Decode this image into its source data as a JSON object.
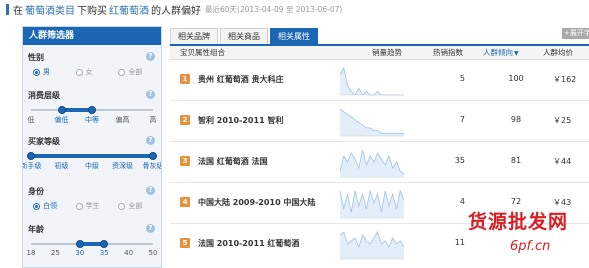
{
  "header": {
    "prefix": "在",
    "category": "葡萄酒类目",
    "mid": "下购买",
    "product": "红葡萄酒",
    "suffix": "的人群偏好",
    "date_range": "最近60天(2013-04-09 至 2013-06-07)"
  },
  "sidebar": {
    "title": "人群筛选器",
    "gender": {
      "label": "性别",
      "options": [
        {
          "label": "男",
          "selected": true
        },
        {
          "label": "女",
          "selected": false
        },
        {
          "label": "全部",
          "selected": false
        }
      ]
    },
    "spend": {
      "label": "消费层级",
      "ticks": [
        "低",
        "偏低",
        "中等",
        "偏高",
        "高"
      ],
      "range": [
        1,
        2
      ]
    },
    "buyer": {
      "label": "买家等级",
      "ticks": [
        "新手级",
        "初级",
        "中级",
        "资深级",
        "骨灰级"
      ],
      "range": [
        0,
        4
      ]
    },
    "identity": {
      "label": "身份",
      "options": [
        {
          "label": "白领",
          "selected": true
        },
        {
          "label": "学生",
          "selected": false
        },
        {
          "label": "全部",
          "selected": false
        }
      ]
    },
    "age": {
      "label": "年龄",
      "ticks": [
        "18",
        "25",
        "30",
        "35",
        "40",
        "50"
      ],
      "range": [
        2,
        3
      ]
    },
    "help_glyph": "?"
  },
  "tabs": [
    {
      "label": "相关品牌",
      "active": false
    },
    {
      "label": "相关商品",
      "active": false
    },
    {
      "label": "相关属性",
      "active": true
    }
  ],
  "export_label": "+展开字",
  "table": {
    "columns": {
      "combo": "宝贝属性组合",
      "trend": "销量趋势",
      "hot": "热销指数",
      "tendency": "人群倾向",
      "avg_price": "人群均价"
    },
    "sort_arrow": "▼",
    "rows": [
      {
        "rank": "1",
        "combo": "贵州 红葡萄酒 贵大科庄",
        "hot": "5",
        "tendency": "100",
        "avg": "￥162",
        "trend": [
          6,
          8,
          3,
          1,
          0,
          2,
          0,
          1,
          0,
          0,
          1,
          0,
          0,
          0,
          0,
          0,
          0,
          0
        ]
      },
      {
        "rank": "2",
        "combo": "智利 2010-2011 智利",
        "hot": "7",
        "tendency": "98",
        "avg": "￥25",
        "trend": [
          10,
          9,
          8,
          7,
          6,
          5,
          4,
          3,
          3,
          2,
          2,
          1,
          1,
          1,
          1,
          1,
          1,
          1
        ]
      },
      {
        "rank": "3",
        "combo": "法国 红葡萄酒 法国",
        "hot": "35",
        "tendency": "81",
        "avg": "￥44",
        "trend": [
          2,
          7,
          5,
          8,
          6,
          3,
          9,
          4,
          7,
          5,
          8,
          6,
          4,
          7,
          3,
          5,
          2,
          1
        ]
      },
      {
        "rank": "4",
        "combo": "中国大陆 2009-2010 中国大陆",
        "hot": "4",
        "tendency": "72",
        "avg": "￥43",
        "trend": [
          9,
          3,
          8,
          2,
          9,
          4,
          8,
          3,
          9,
          5,
          8,
          2,
          9,
          4,
          8,
          3,
          9,
          6
        ]
      },
      {
        "rank": "5",
        "combo": "法国 2010-2011 红葡萄酒",
        "hot": "11",
        "tendency": "",
        "avg": "",
        "trend": [
          8,
          9,
          5,
          6,
          7,
          4,
          8,
          6,
          5,
          7,
          9,
          5,
          6,
          4,
          7,
          5,
          6,
          4
        ]
      }
    ]
  },
  "watermark": {
    "line1": "货源批发网",
    "line2": "6pf.cn"
  },
  "colors": {
    "accent": "#1c67b4",
    "rank_badge": "#e8913c",
    "trend_line": "#9cc3e8",
    "watermark": "#d81f26"
  }
}
